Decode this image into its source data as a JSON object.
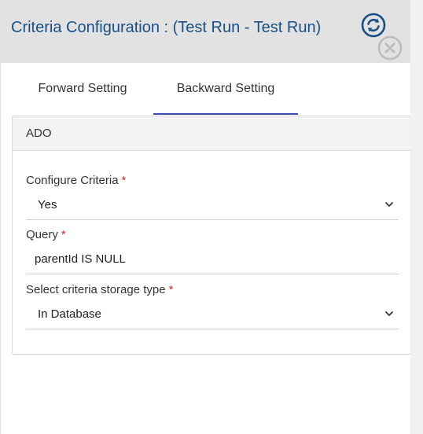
{
  "header": {
    "title": "Criteria Configuration : (Test Run - Test Run)",
    "colors": {
      "title": "#1a4f86",
      "background": "#e2e2e2"
    }
  },
  "icons": {
    "refresh": "refresh-icon",
    "close": "close-icon",
    "chevron": "chevron-down-icon"
  },
  "tabs": [
    {
      "label": "Forward Setting",
      "active": false
    },
    {
      "label": "Backward Setting",
      "active": true
    }
  ],
  "section": {
    "title": "ADO",
    "fields": [
      {
        "label": "Configure Criteria",
        "required_mark": "*",
        "value": "Yes",
        "type": "select"
      },
      {
        "label": "Query",
        "required_mark": "*",
        "value": "parentId IS NULL",
        "type": "text"
      },
      {
        "label": "Select criteria storage type",
        "required_mark": "*",
        "value": "In Database",
        "type": "select"
      }
    ]
  },
  "accent_color": "#3a48a8",
  "required_color": "#d22d2d"
}
